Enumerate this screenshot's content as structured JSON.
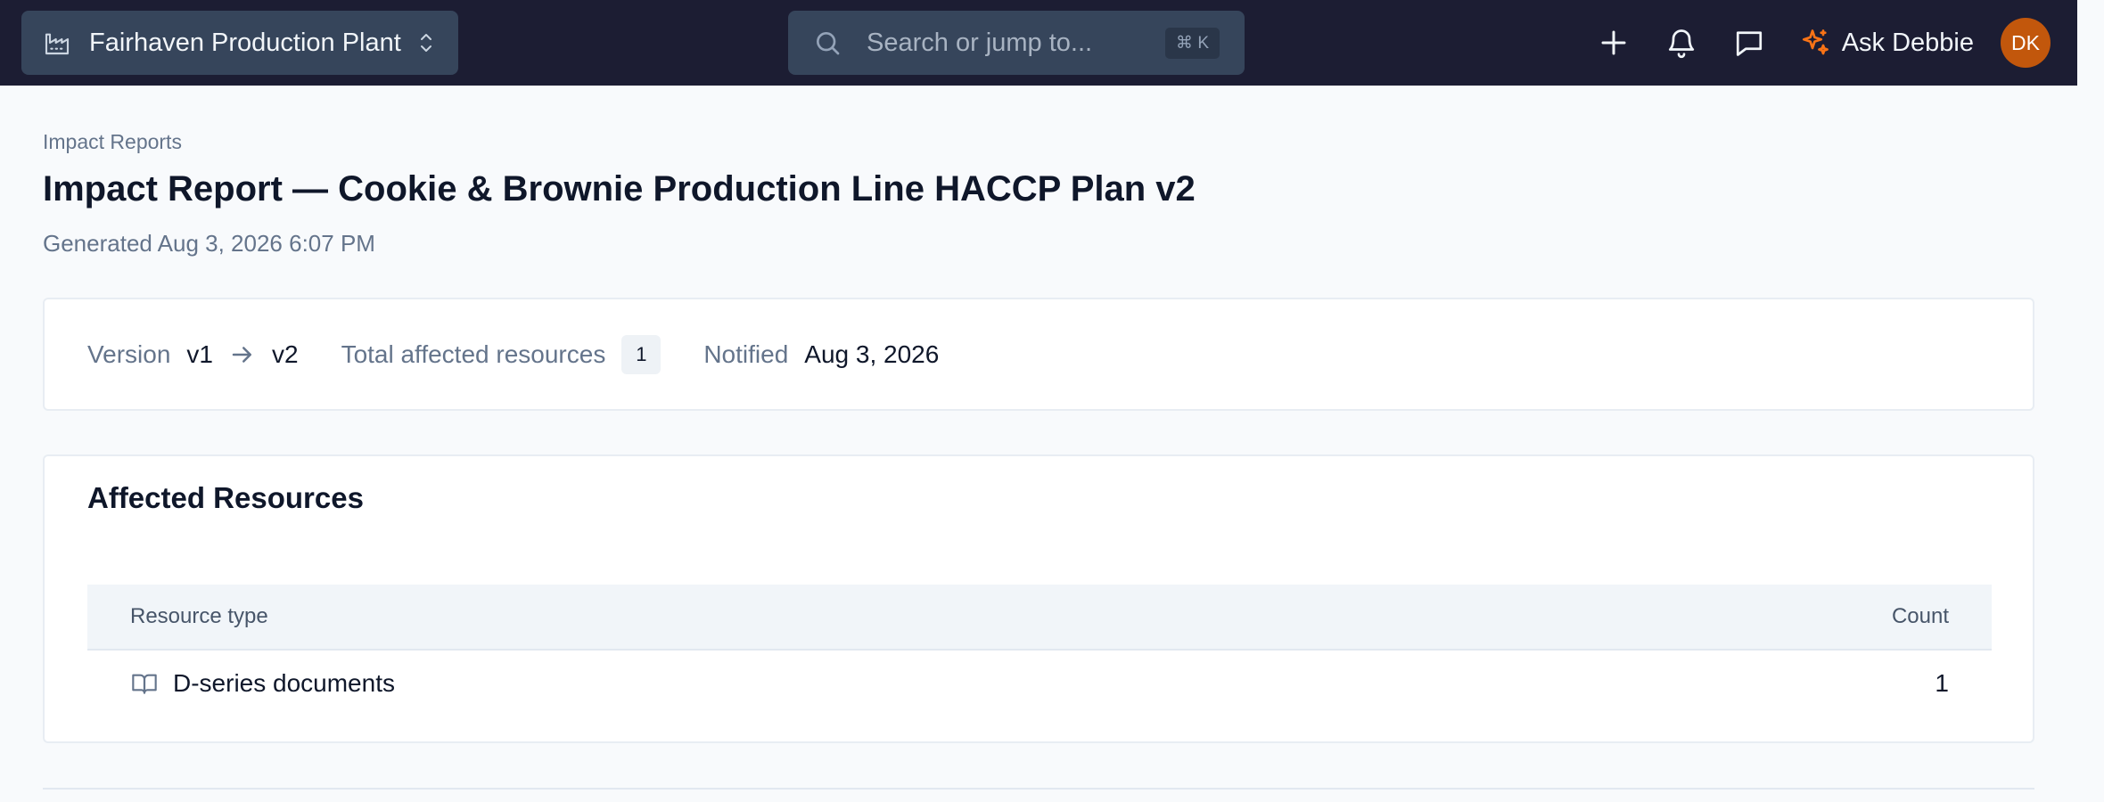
{
  "topbar": {
    "plant_name": "Fairhaven Production Plant",
    "search_placeholder": "Search or jump to...",
    "search_shortcut": "⌘ K",
    "ask_label": "Ask Debbie",
    "avatar_initials": "DK",
    "icons": [
      "factory-icon",
      "chevrons-up-down-icon",
      "search-icon",
      "plus-icon",
      "bell-icon",
      "message-icon",
      "sparkles-icon"
    ],
    "colors": {
      "bar": "#1c1d33",
      "control": "#36455b",
      "ask_accent": "#f97316",
      "avatar": "#c2570c"
    }
  },
  "page": {
    "breadcrumb": "Impact Reports",
    "title": "Impact Report — Cookie & Brownie Production Line HACCP Plan v2",
    "generated": "Generated Aug 3, 2026 6:07 PM"
  },
  "summary": {
    "version_label": "Version",
    "version_from": "v1",
    "version_to": "v2",
    "total_label": "Total affected resources",
    "total_count": "1",
    "notified_label": "Notified",
    "notified_date": "Aug 3, 2026"
  },
  "resources": {
    "title": "Affected Resources",
    "columns": [
      "Resource type",
      "Count"
    ],
    "rows": [
      {
        "icon": "book-open-icon",
        "type": "D-series documents",
        "count": "1"
      }
    ]
  }
}
